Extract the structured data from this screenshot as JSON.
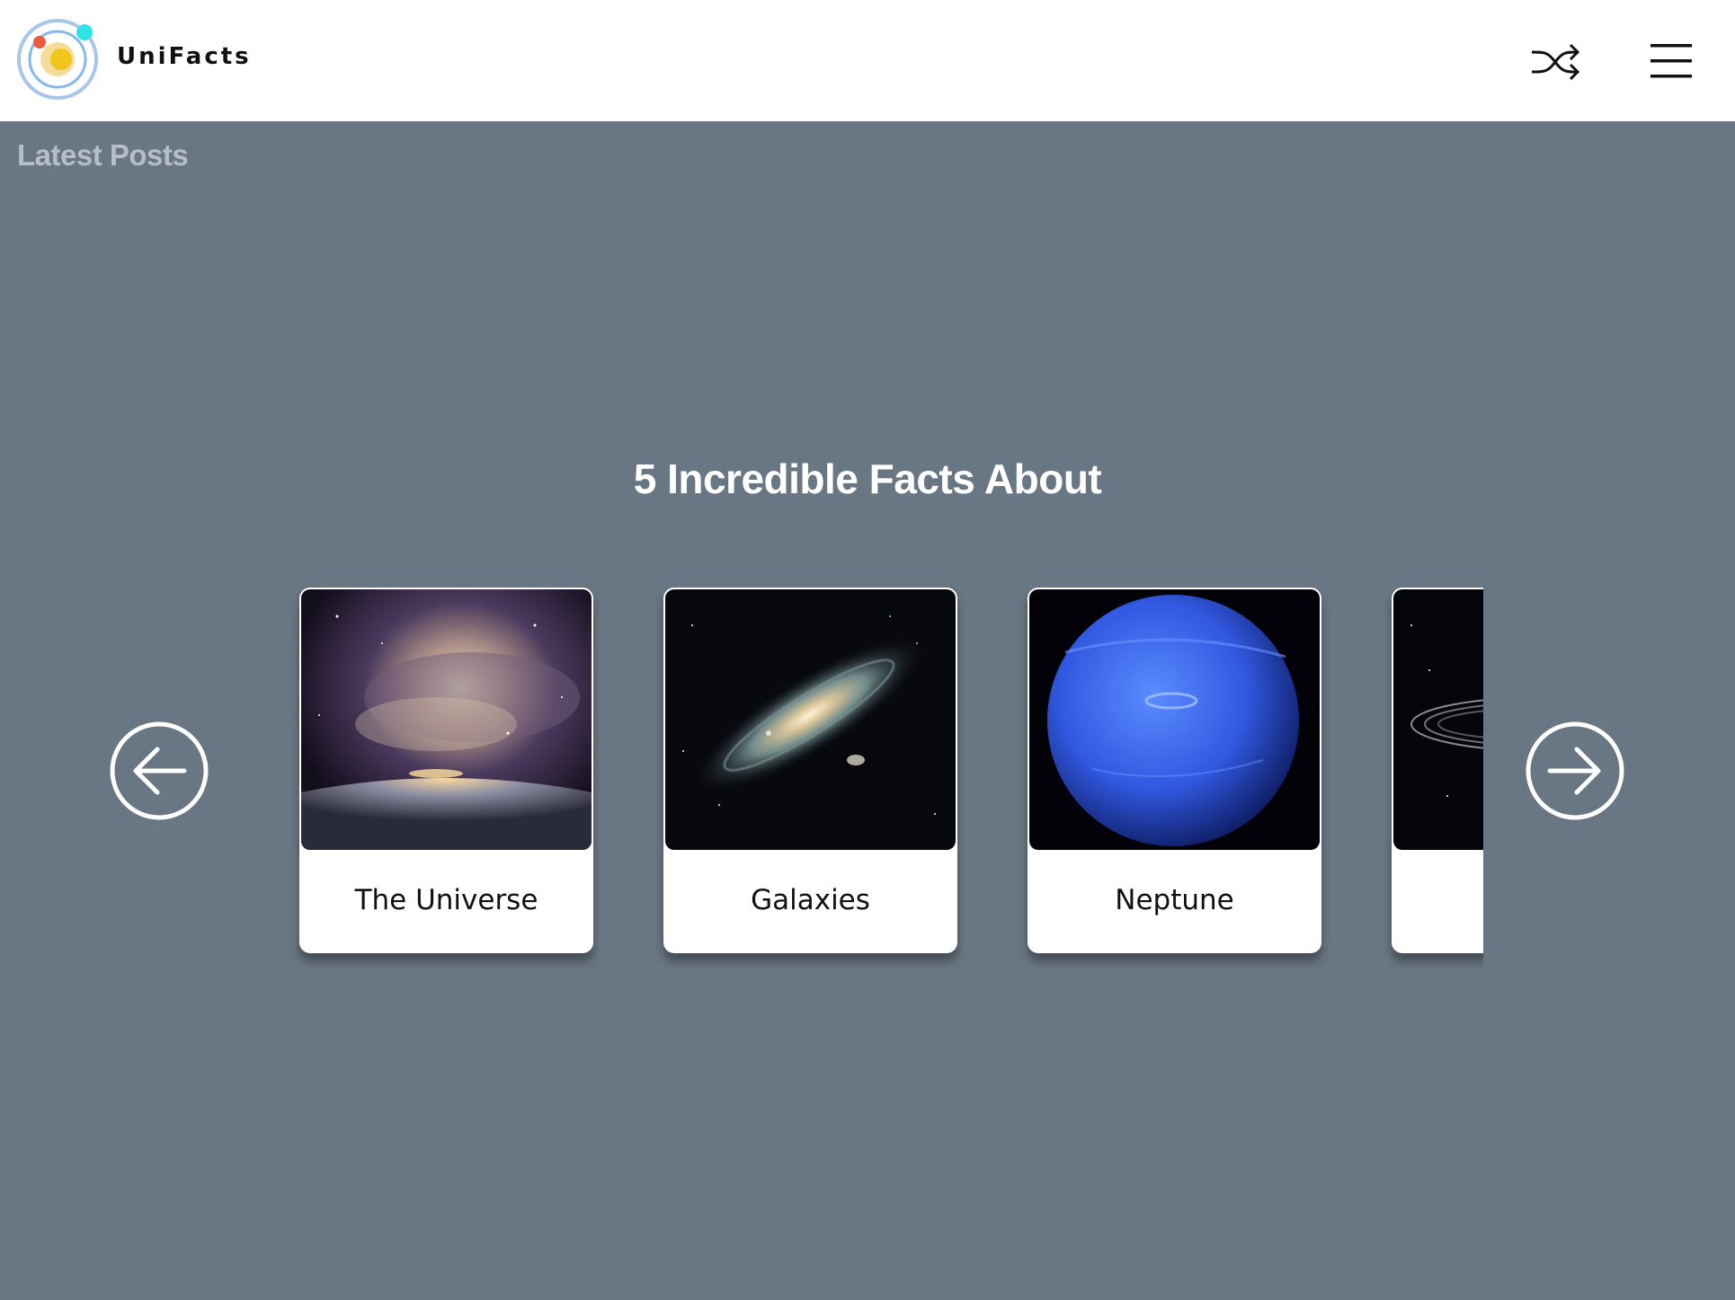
{
  "header": {
    "brand": "UniFacts",
    "logo_icon": "orbit-logo-icon",
    "shuffle_icon": "shuffle-icon",
    "menu_icon": "hamburger-menu-icon"
  },
  "main": {
    "section_label": "Latest Posts",
    "heading": "5 Incredible Facts About",
    "prev_icon": "arrow-left-circle-icon",
    "next_icon": "arrow-right-circle-icon",
    "cards": [
      {
        "title": "The Universe",
        "image": "nebula-over-earth-image"
      },
      {
        "title": "Galaxies",
        "image": "spiral-galaxy-image"
      },
      {
        "title": "Neptune",
        "image": "neptune-planet-image"
      },
      {
        "title": "",
        "image": "ringed-planet-image"
      }
    ]
  },
  "colors": {
    "background": "#697683",
    "header": "#ffffff",
    "card": "#ffffff",
    "section_label": "#b6bec8",
    "heading": "#ffffff"
  }
}
